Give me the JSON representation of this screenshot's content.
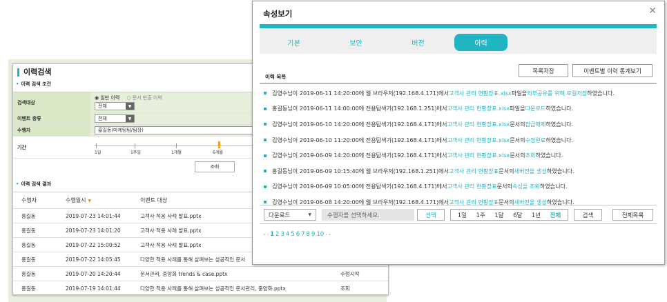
{
  "background_panel": {
    "title": "이력검색",
    "conditions_label": "이력 검색 조건",
    "results_label": "이력 검색 결과",
    "target": {
      "label": "검색대상",
      "radio_general": "일반 이력",
      "radio_export": "문서 반출 이력",
      "select": "전체"
    },
    "event": {
      "label": "이벤트 종류",
      "select": "전체"
    },
    "performer": {
      "label": "수행자",
      "value": "홍길동(마케팅팀/팀장)"
    },
    "period": {
      "label": "기간",
      "ticks": [
        "1일",
        "1주일",
        "1개월",
        "6개월"
      ]
    },
    "query_button": "조회",
    "table": {
      "headers": [
        "수행자",
        "수행일시",
        "이벤트 대상",
        ""
      ],
      "rows": [
        [
          "홍길동",
          "2019-07-23 14:01:44",
          "고객사 적용 사례 발표.pptx",
          ""
        ],
        [
          "홍길동",
          "2019-07-23 14:01:20",
          "고객사 적용 사례 발표.pptx",
          ""
        ],
        [
          "홍길동",
          "2019-07-22 15:00:52",
          "고객사 적용 사례 발표.pptx",
          ""
        ],
        [
          "홍길동",
          "2019-07-22 14:05:45",
          "다양한 적용 사례를 통해 살펴보는 성공적인 문서",
          ""
        ],
        [
          "홍길동",
          "2019-07-20 14:20:44",
          "문서관리, 중앙화 trends & case.pptx",
          "수정시작"
        ],
        [
          "홍길동",
          "2019-07-19 14:01:44",
          "다양한 적용 사례를 통해 살펴보는 성공적인 문서관리, 중앙화.pptx",
          "조회"
        ]
      ]
    }
  },
  "dialog": {
    "title": "속성보기",
    "close_icon": "close-icon",
    "tabs": [
      "기본",
      "보안",
      "버전",
      "이력"
    ],
    "active_tab": "이력",
    "history_label": "이력 목록",
    "save_button": "목록저장",
    "stats_button": "이벤트별 이력 통계보기",
    "history": [
      {
        "pre": "김영수님이 2019-06-11 14:20:00에 웹 브라우저(192.168.4.171)에서 ",
        "file": "고객사 관리 현황장표.xlsx",
        "mid": " 파일을 ",
        "action": "외부공유를 위해 로컬저장",
        "post": "하였습니다."
      },
      {
        "pre": "홍길동님이 2019-06-11 14:00:00에 전용탐색기(192.168.1.251)에서 ",
        "file": "고객사 관리 현황장표.xlsx",
        "mid": " 파일을 ",
        "action": "다운로드",
        "post": "하였습니다."
      },
      {
        "pre": "김영수님이 2019-06-10 14:20:00에 전용탐색기(192.168.4.171)에서 ",
        "file": "고객사 관리 현황장표.xlsx",
        "mid": " 문서의 ",
        "action": "잠금해제",
        "post": "하였습니다."
      },
      {
        "pre": "김영수님이 2019-06-10 11:20:00에 전용탐색기(192.168.4.171)에서 ",
        "file": "고객사 관리 현황장표.xlsx",
        "mid": " 문서의 ",
        "action": "수정완료",
        "post": "하였습니다."
      },
      {
        "pre": "김영수님이 2019-06-09 14:20:00에 전용탐색기(192.168.4.171)에서 ",
        "file": "고객사 관리 현황장표.xlsx",
        "mid": " 문서의 ",
        "action": "조회",
        "post": "하였습니다."
      },
      {
        "pre": "홍길동님이 2019-06-09 10:15:40에 웹 브라우저(192.168.1.251)에서 ",
        "file": "고객사 관리 현황장표",
        "mid": " 문서의 ",
        "action": "새버전을 생성",
        "post": "하였습니다."
      },
      {
        "pre": "김영수님이 2019-06-09 10:05:00에 전용탐색기(192.168.4.171)에서 ",
        "file": "고객사 관리 현황장표",
        "mid": " 문서의 ",
        "action": "속성을 조회",
        "post": "하였습니다."
      },
      {
        "pre": "김영수님이 2019-06-08 14:20:00에 웹 브라우저(192.168.4.171)에서 ",
        "file": "고객사 관리 현황장표",
        "mid": " 문서의 ",
        "action": "새버전을 생성",
        "post": "하였습니다."
      }
    ],
    "download_select": "다운로드",
    "performer_placeholder": "수행자를 선택하세요.",
    "select_button": "선택",
    "periods": [
      "1일",
      "1주",
      "1달",
      "6달",
      "1년",
      "전체"
    ],
    "active_period": "전체",
    "search_button": "검색",
    "all_list_button": "전체목록",
    "pagination": {
      "first": "«",
      "prev": "‹",
      "pages": [
        "1",
        "2",
        "3",
        "4",
        "5",
        "6",
        "7",
        "8",
        "9",
        "10"
      ],
      "next": "›",
      "last": "»",
      "current": "1"
    }
  },
  "colors": {
    "accent": "#1fb5c3",
    "condition_bg": "#dbe8c8",
    "sort_arrow": "#f08a00"
  }
}
